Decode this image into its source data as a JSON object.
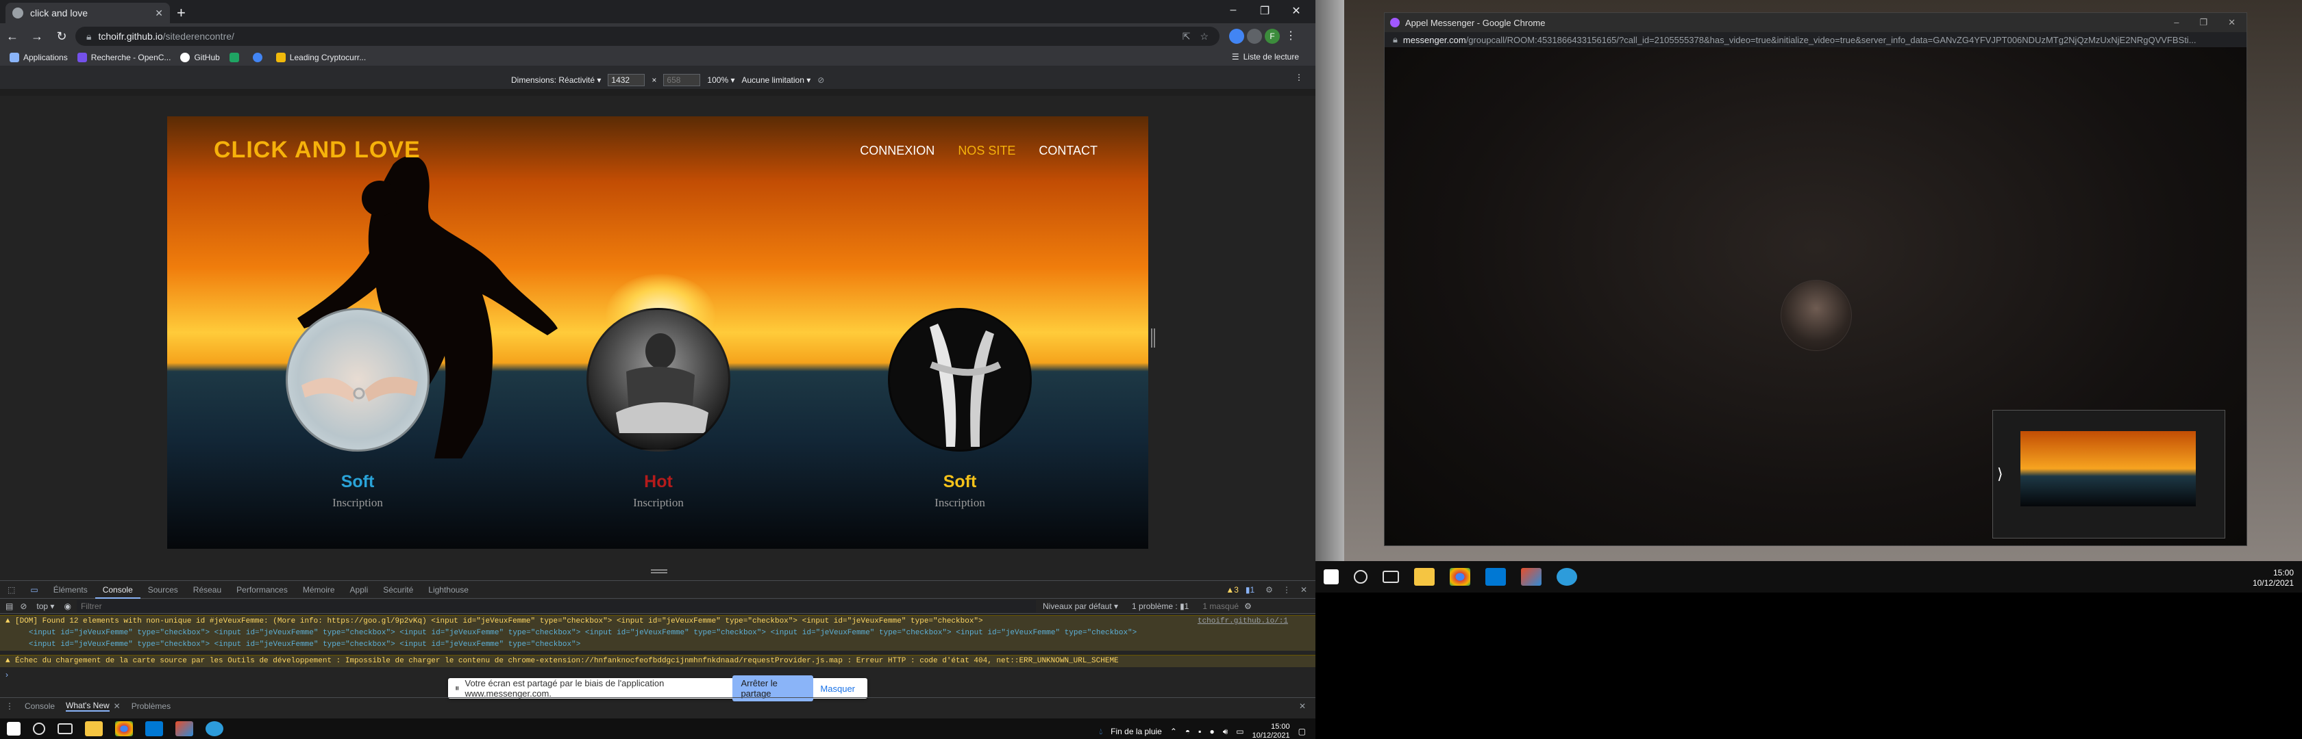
{
  "left_browser": {
    "tab_title": "click and love",
    "url_host": "tchoifr.github.io",
    "url_path": "/sitederencontre/",
    "window_controls": [
      "–",
      "❐",
      "✕"
    ],
    "bookmarks": [
      "Applications",
      "Recherche - OpenC...",
      "GitHub",
      "Leading Cryptocurr..."
    ],
    "reading_list": "Liste de lecture",
    "device_toolbar": {
      "dimensions_label": "Dimensions: Réactivité ▾",
      "width": "1432",
      "times": "×",
      "height": "658",
      "zoom": "100% ▾",
      "throttle": "Aucune limitation ▾"
    }
  },
  "site": {
    "logo": "CLICK AND LOVE",
    "nav": [
      "CONNEXION",
      "NOS SITE",
      "CONTACT"
    ],
    "cards": [
      {
        "title": "Soft",
        "subtitle": "Inscription",
        "color": "#2aa3d8"
      },
      {
        "title": "Hot",
        "subtitle": "Inscription",
        "color": "#b51b1b"
      },
      {
        "title": "Soft",
        "subtitle": "Inscription",
        "color": "#f4c21a"
      }
    ]
  },
  "devtools": {
    "tabs": [
      "Éléments",
      "Console",
      "Sources",
      "Réseau",
      "Performances",
      "Mémoire",
      "Appli",
      "Sécurité",
      "Lighthouse"
    ],
    "active_tab": "Console",
    "context": "top ▾",
    "filter_placeholder": "Filtrer",
    "levels": "Niveaux par défaut ▾",
    "issues": "1 problème : ▮1",
    "hidden": "1 masqué",
    "badge_warnings": "▲3",
    "badge_issues": "▮1",
    "message1": "[DOM] Found 12 elements with non-unique id #jeVeuxFemme: (More info: https://goo.gl/9p2vKq)  <input id=\"jeVeuxFemme\" type=\"checkbox\">  <input id=\"jeVeuxFemme\" type=\"checkbox\">  <input id=\"jeVeuxFemme\" type=\"checkbox\">",
    "message1_line2": "<input id=\"jeVeuxFemme\" type=\"checkbox\">  <input id=\"jeVeuxFemme\" type=\"checkbox\">  <input id=\"jeVeuxFemme\" type=\"checkbox\">  <input id=\"jeVeuxFemme\" type=\"checkbox\">  <input id=\"jeVeuxFemme\" type=\"checkbox\">  <input id=\"jeVeuxFemme\" type=\"checkbox\">",
    "message1_line3": "<input id=\"jeVeuxFemme\" type=\"checkbox\">  <input id=\"jeVeuxFemme\" type=\"checkbox\">  <input id=\"jeVeuxFemme\" type=\"checkbox\">",
    "message1_source": "tchoifr.github.io/:1",
    "message2": "Échec du chargement de la carte source par les Outils de développement : Impossible de charger le contenu de chrome-extension://hnfanknocfeofbddgcijnmhnfnkdnaad/requestProvider.js.map : Erreur HTTP : code d'état 404, net::ERR_UNKNOWN_URL_SCHEME",
    "drawer_tabs": [
      "Console",
      "What's New",
      "Problèmes"
    ],
    "share_text": "Votre écran est partagé par le biais de l'application www.messenger.com.",
    "share_stop": "Arrêter le partage",
    "share_hide": "Masquer"
  },
  "taskbar_left": {
    "weather": "Fin de la pluie",
    "time": "15:00",
    "date": "10/12/2021"
  },
  "right_window": {
    "title": "Appel Messenger - Google Chrome",
    "url_host": "messenger.com",
    "url_path": "/groupcall/ROOM:4531866433156165/?call_id=2105555378&has_video=true&initialize_video=true&server_info_data=GANvZG4YFVJPT006NDUzMTg2NjQzMzUxNjE2NRgQVVFBSti..."
  },
  "taskbar_right": {
    "time": "15:00",
    "date": "10/12/2021"
  }
}
